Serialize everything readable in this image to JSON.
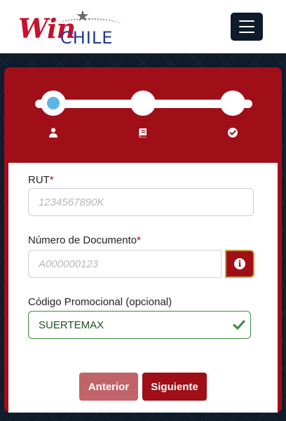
{
  "header": {
    "logo": {
      "brand_win": "Win",
      "brand_chile": "CHILE"
    },
    "menu_icon": "hamburger-menu-icon"
  },
  "stepper": {
    "steps": [
      {
        "icon": "user-icon",
        "state": "active"
      },
      {
        "icon": "book-icon",
        "state": "pending"
      },
      {
        "icon": "check-circle-icon",
        "state": "pending"
      }
    ],
    "active_color": "#5bb5e6"
  },
  "form": {
    "rut": {
      "label": "RUT",
      "required_mark": "*",
      "placeholder": "1234567890K",
      "value": ""
    },
    "document": {
      "label": "Número de Documento",
      "required_mark": "*",
      "placeholder": "A000000123",
      "value": "",
      "info_icon": "info-icon"
    },
    "promo": {
      "label": "Código Promocional (opcional)",
      "value": "SUERTEMAX",
      "status_icon": "check-icon"
    }
  },
  "buttons": {
    "previous": "Anterior",
    "next": "Siguiente"
  },
  "colors": {
    "brand_red": "#a00e17",
    "header_dark": "#0f1b2b",
    "success_green": "#3b8a3e",
    "previous_button": "#c0646a"
  }
}
